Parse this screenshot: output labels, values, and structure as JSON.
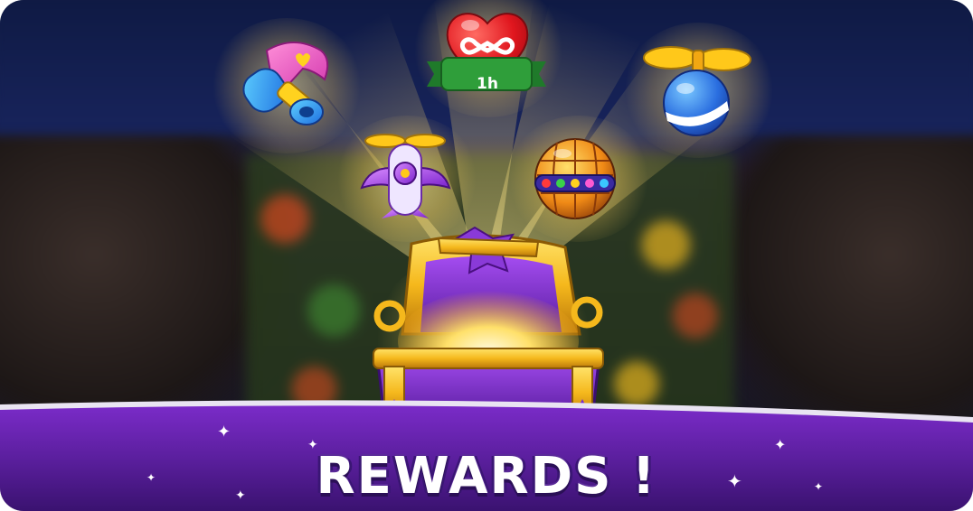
{
  "scene": {
    "title": "REWARDS !",
    "timer_label": "1h",
    "rewards": [
      {
        "name": "hammer",
        "icon": "hammer-icon"
      },
      {
        "name": "infinite-lives-heart",
        "icon": "heart-infinity-icon"
      },
      {
        "name": "propeller",
        "icon": "propeller-icon"
      },
      {
        "name": "plane",
        "icon": "plane-icon"
      },
      {
        "name": "disco-ball",
        "icon": "disco-ball-icon"
      }
    ],
    "colors": {
      "banner_purple": "#5b1f9e",
      "banner_edge": "#3a1270",
      "gold": "#f5b81c",
      "chest_purple": "#7b2bd0",
      "heart_red": "#e0161e",
      "badge_green": "#2f9e3a"
    }
  }
}
